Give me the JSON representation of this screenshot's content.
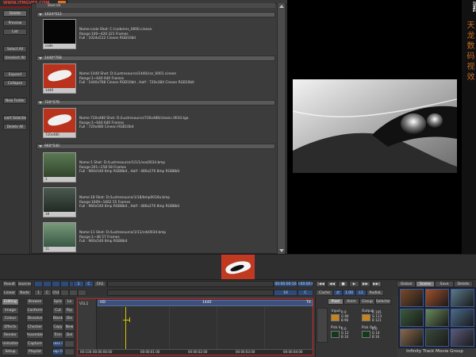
{
  "brand": {
    "url": "WWW.ITMGVFX.COM",
    "vertical_text": "天龙数码视效",
    "logo": "ITMG"
  },
  "library": {
    "buttons": [
      "Delete",
      "Preview",
      "List",
      "Select All",
      "Unselect All",
      "Expand",
      "Collapse",
      "New Folder",
      "Invert Selection",
      "Delete All"
    ],
    "top_label": "Shot list",
    "groups": [
      {
        "label": "1024*512",
        "items": [
          {
            "caption": "code",
            "lines": [
              "Name:code Shot: C:/code/res_0000.cineon",
              "Range:100~420 321 Frames",
              "Full : 1024x512  Cineon RGB10bit"
            ]
          }
        ]
      },
      {
        "label": "1440*768",
        "items": [
          {
            "caption": "1440",
            "lines": [
              "Name:1440 Shot: D:/Lustresource/1440/car_0001.cineon",
              "Range:1~640 640 Frames",
              "Full : 1440x768  Cineon RGB10bit , Half : 720x384  Cineon RGB10bit"
            ]
          }
        ]
      },
      {
        "label": "720*576",
        "items": [
          {
            "caption": "720x480",
            "lines": [
              "Name:720x480 Shot: D:/Lustresource/720x480/classic.0034.tga",
              "Range:1~640 640 Frames",
              "Full : 720x480  Cineon RGB10bit"
            ]
          }
        ]
      },
      {
        "label": "960*540",
        "items": [
          {
            "caption": "1",
            "lines": [
              "Name:1 Shot: D:/Lustresource/1/1/1/nos0034.bmp",
              "Range:201~258 58 Frames",
              "Full : 960x540  8mp RGB8bit , Half : 480x270  8mp RGB8bit"
            ]
          },
          {
            "caption": "18",
            "lines": [
              "Name:18 Shot: D:/Lustresource/1/18/bmp0034a.bmp",
              "Range:1609~1662 55 Frames",
              "Full : 960x540  8mp RGB8bit , Half : 480x270  8mp RGB8bit"
            ]
          },
          {
            "caption": "11",
            "lines": [
              "Name:11 Shot: D:/Lustresource/1/11/cds0034.bmp",
              "Range:1~48 57 Frames",
              "Full : 960x540  8mp RGB8bit"
            ]
          }
        ]
      }
    ]
  },
  "transport": {
    "left": [
      "Result",
      "Sources",
      "Linear",
      "Node"
    ],
    "middle": [
      "",
      "",
      "",
      "",
      "",
      "1",
      "C",
      "Ch1",
      "",
      "",
      ""
    ],
    "timecode_in": "00:00:00:16",
    "timecode_out": "16",
    "c_label": "C",
    "timecode_right": "00:00:00:00",
    "cache": "Cache",
    "speed": "1.00",
    "l1": "L1",
    "audio": "AudioL",
    "right": [
      "Global",
      "Scene",
      "Save",
      "Delete"
    ]
  },
  "menu": {
    "col1": [
      "Editing",
      "Image",
      "Colour",
      "Effects",
      "Render",
      "Animation",
      "Setup"
    ],
    "col2": [
      "Browse",
      "Conform",
      "Dissolve",
      "Checker",
      "Assemble",
      "Capture",
      "Playlist"
    ],
    "col3": [
      "Splic",
      "Cut",
      "Blank",
      "Copy",
      "Trim",
      "Bypass OFF",
      "Swap OFF"
    ],
    "col4": [
      "Lo",
      "Rip",
      "Dis",
      "New",
      "Del",
      "",
      ""
    ]
  },
  "timeline": {
    "track": "V1L1",
    "clips": [
      "HD",
      "1440",
      "TX"
    ],
    "bottom_left": "00:C00:",
    "times": [
      "00:00:00:00",
      "00:00:01:00",
      "00:00:02:00",
      "00:00:03:00",
      "00:00:04:00"
    ]
  },
  "color_panel": {
    "tabs": [
      "Pixel",
      "Anim",
      "Group",
      "Selector"
    ],
    "input_label": "Input",
    "output_label": "Output",
    "rgb_in": [
      "R  0",
      "G  84",
      "B  96"
    ],
    "rgb_out": [
      "R  105",
      "G  113",
      "B  121"
    ],
    "pick_in": "Pick In",
    "pick_out": "Pick Out",
    "pick_in_vals": [
      "R  0",
      "G  12",
      "B  10"
    ],
    "pick_out_vals": [
      "R  0",
      "G  14",
      "B  16"
    ]
  },
  "footer": "Infinity Track Movie Group"
}
